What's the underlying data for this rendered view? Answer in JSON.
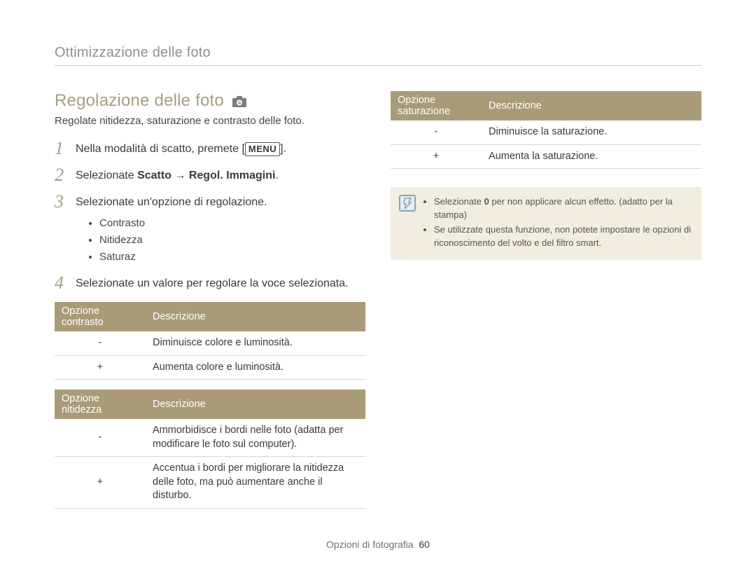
{
  "header": {
    "title": "Ottimizzazione delle foto"
  },
  "section": {
    "title": "Regolazione delle foto",
    "subtitle": "Regolate nitidezza, saturazione e contrasto delle foto."
  },
  "steps": {
    "s1": {
      "num": "1",
      "pre": "Nella modalità di scatto, premete [",
      "button": "MENU",
      "post": "]."
    },
    "s2": {
      "num": "2",
      "pre": "Selezionate ",
      "bold": "Scatto → Regol. Immagini",
      "post": "."
    },
    "s3": {
      "num": "3",
      "text": "Selezionate un'opzione di regolazione."
    },
    "s3_bullets": [
      "Contrasto",
      "Nitidezza",
      "Saturaz"
    ],
    "s4": {
      "num": "4",
      "text": "Selezionate un valore per regolare la voce selezionata."
    }
  },
  "tables": {
    "contrasto": {
      "h1": "Opzione contrasto",
      "h2": "Descrizione",
      "rows": [
        {
          "opt": "-",
          "desc": "Diminuisce colore e luminosità."
        },
        {
          "opt": "+",
          "desc": "Aumenta colore e luminosità."
        }
      ]
    },
    "nitidezza": {
      "h1": "Opzione nitidezza",
      "h2": "Descrizione",
      "rows": [
        {
          "opt": "-",
          "desc": "Ammorbidisce i bordi nelle foto (adatta per modificare le foto sul computer)."
        },
        {
          "opt": "+",
          "desc": "Accentua i bordi per migliorare la nitidezza delle foto, ma può aumentare anche il disturbo."
        }
      ]
    },
    "saturazione": {
      "h1": "Opzione saturazione",
      "h2": "Descrizione",
      "rows": [
        {
          "opt": "-",
          "desc": "Diminuisce la saturazione."
        },
        {
          "opt": "+",
          "desc": "Aumenta la saturazione."
        }
      ]
    }
  },
  "info": {
    "l1_pre": "Selezionate ",
    "l1_bold": "0",
    "l1_post": " per non applicare alcun effetto. (adatto per la stampa)",
    "l2": "Se utilizzate questa funzione, non potete impostare le opzioni di riconoscimento del volto e del filtro smart."
  },
  "footer": {
    "label": "Opzioni di fotografia",
    "page": "60"
  }
}
